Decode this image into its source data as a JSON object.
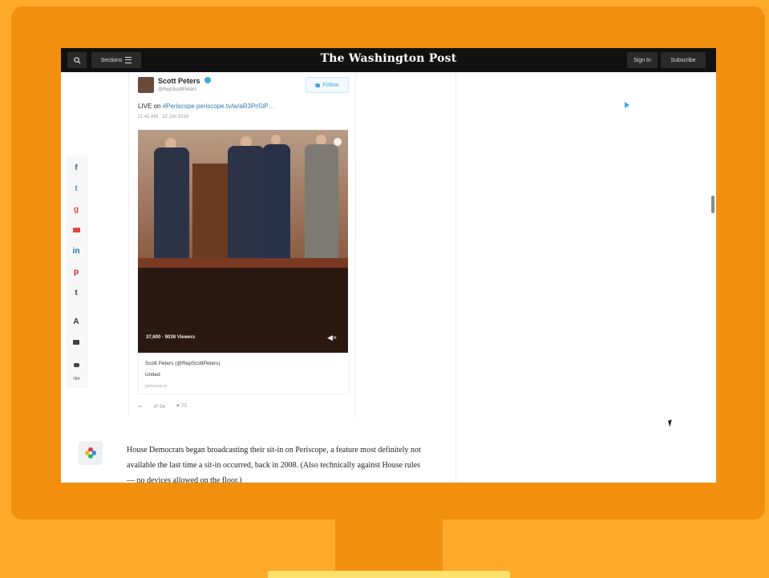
{
  "topbar": {
    "sections_label": "Sections",
    "logo": "The Washington Post",
    "signin_label": "Sign In",
    "subscribe_label": "Subscribe",
    "icons": [
      "search-icon",
      "menu-icon"
    ]
  },
  "share_rail": {
    "items": [
      "facebook-icon",
      "twitter-icon",
      "google-plus-icon",
      "email-icon",
      "linkedin-icon",
      "pinterest-icon",
      "tumblr-icon",
      "text-size-icon",
      "print-icon",
      "comments-icon"
    ],
    "comment_count": "784"
  },
  "tweet": {
    "name": "Scott Peters",
    "handle": "@RepScottPeters",
    "follow_label": "Follow",
    "text_prefix": "LIVE on ",
    "text_link": "#Periscope periscope.tv/w/aR3Pn5tP…",
    "time": "11:41 AM · 22 Jun 2016",
    "video_viewers": "37,600 · 9036 Viewers",
    "card_title": "Scott Peters (@RepScottPeters)",
    "card_subtitle": "United",
    "card_domain": "periscope.tv",
    "retweets": "54",
    "likes": "70"
  },
  "article": {
    "paragraph": "House Democrats began broadcasting their sit-in on Periscope, a feature most definitely not available the last time a sit-in occurred, back in 2008. (Also technically against House rules — no devices allowed on the floor.)"
  },
  "colors": {
    "frame": "#f28f0e",
    "background": "#fdaa2a",
    "stand_base": "#fbe16b",
    "topbar": "#111111",
    "twitter_blue": "#3ea6e0"
  }
}
